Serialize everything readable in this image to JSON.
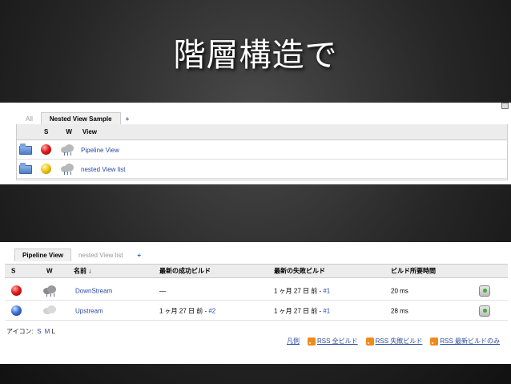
{
  "slide": {
    "title": "階層構造で"
  },
  "panel1": {
    "top_link": "",
    "tabs": [
      {
        "label": "All",
        "active": false
      },
      {
        "label": "Nested View Sample",
        "active": true
      },
      {
        "label": "+",
        "active": false
      }
    ],
    "headers": {
      "s": "S",
      "w": "W",
      "view": "View"
    },
    "rows": [
      {
        "status": "red",
        "name": "Pipeline View",
        "icon": "folder-icon"
      },
      {
        "status": "yellow",
        "name": "nested View list",
        "icon": "folder-icon"
      }
    ]
  },
  "panel2": {
    "tabs": [
      {
        "label": "Pipeline View",
        "active": true
      },
      {
        "label": "nested View list",
        "active": false
      },
      {
        "label": "+",
        "active": false
      }
    ],
    "headers": {
      "s": "S",
      "w": "W",
      "name": "名前 ↓",
      "last_success": "最新の成功ビルド",
      "last_failure": "最新の失敗ビルド",
      "duration": "ビルド所要時間"
    },
    "jobs": [
      {
        "status": "red",
        "name": "DownStream",
        "last_success": "—",
        "last_failure_text": "1 ヶ月 27 日 前 - ",
        "last_failure_link": "#1",
        "duration": "20 ms"
      },
      {
        "status": "blue",
        "name": "Upstream",
        "last_success_text": "1 ヶ月 27 日 前 - ",
        "last_success_link": "#2",
        "last_failure_text": "1 ヶ月 27 日 前 - ",
        "last_failure_link": "#1",
        "duration": "28 ms"
      }
    ],
    "legend": {
      "label": "アイコン:",
      "s": "S",
      "m": "M",
      "l": "L"
    },
    "footer": {
      "legend_link": "凡例",
      "rss_all": "RSS 全ビルド",
      "rss_failed": "RSS 失敗ビルド",
      "rss_latest": "RSS 最新ビルドのみ"
    }
  },
  "colors": {
    "link": "#2a4aa0",
    "red_ball": "#e21d1d",
    "yellow_ball": "#f2c81a",
    "blue_ball": "#3f72d8",
    "rss": "#f08a1c"
  }
}
